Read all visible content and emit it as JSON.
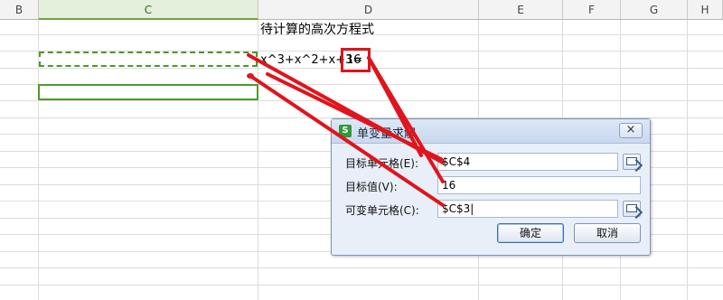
{
  "spreadsheet": {
    "columns": [
      "B",
      "C",
      "D",
      "E",
      "F",
      "G",
      "H"
    ],
    "active_column": "C",
    "title_cell": "待计算的高次方程式",
    "equation_cell": "x^3+x^2+x+3=",
    "equation_value": "16"
  },
  "dialog": {
    "title": "单变量求解",
    "close_label": "×",
    "target_cell_label": "目标单元格(E):",
    "target_cell_value": "$C$4",
    "target_value_label": "目标值(V):",
    "target_value": "16",
    "changing_cell_label": "可变单元格(C):",
    "changing_cell_value": "$C$3|",
    "ok_label": "确定",
    "cancel_label": "取消"
  },
  "colors": {
    "active_green": "#4f9a2a",
    "annotation_red": "#e0141c",
    "dialog_bg": "#e8eff9"
  }
}
